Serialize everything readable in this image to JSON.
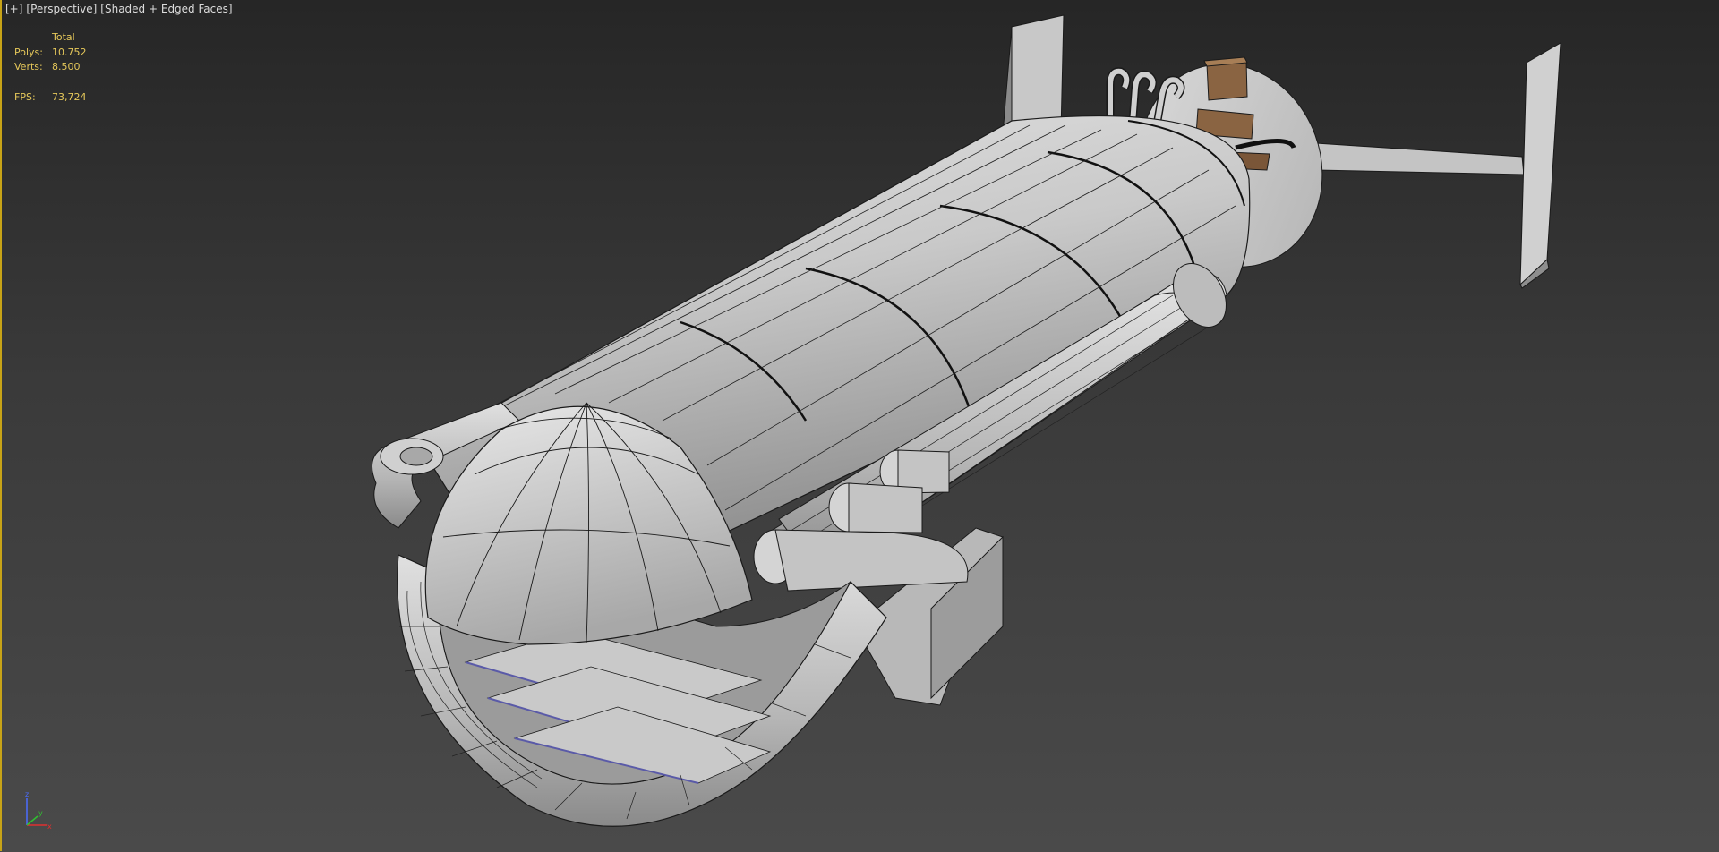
{
  "viewport": {
    "plus_menu": "[+]",
    "view_menu": "[Perspective]",
    "shading_menu": "[Shaded + Edged Faces]"
  },
  "stats": {
    "header": "Total",
    "polys_label": "Polys:",
    "polys_value": "10.752",
    "verts_label": "Verts:",
    "verts_value": "8.500",
    "fps_label": "FPS:",
    "fps_value": "73,724"
  },
  "gizmo": {
    "z_label": "z",
    "x_label": "x",
    "y_label": "y"
  },
  "colors": {
    "accent": "#c7a317",
    "stat_text": "#e6c85a",
    "model_light": "#d4d4d4",
    "model_mid": "#a9a9a9",
    "model_dark": "#7c7c7c",
    "wire": "#111111",
    "crate": "#8a6442",
    "blue_edge": "#5a5aa8"
  }
}
